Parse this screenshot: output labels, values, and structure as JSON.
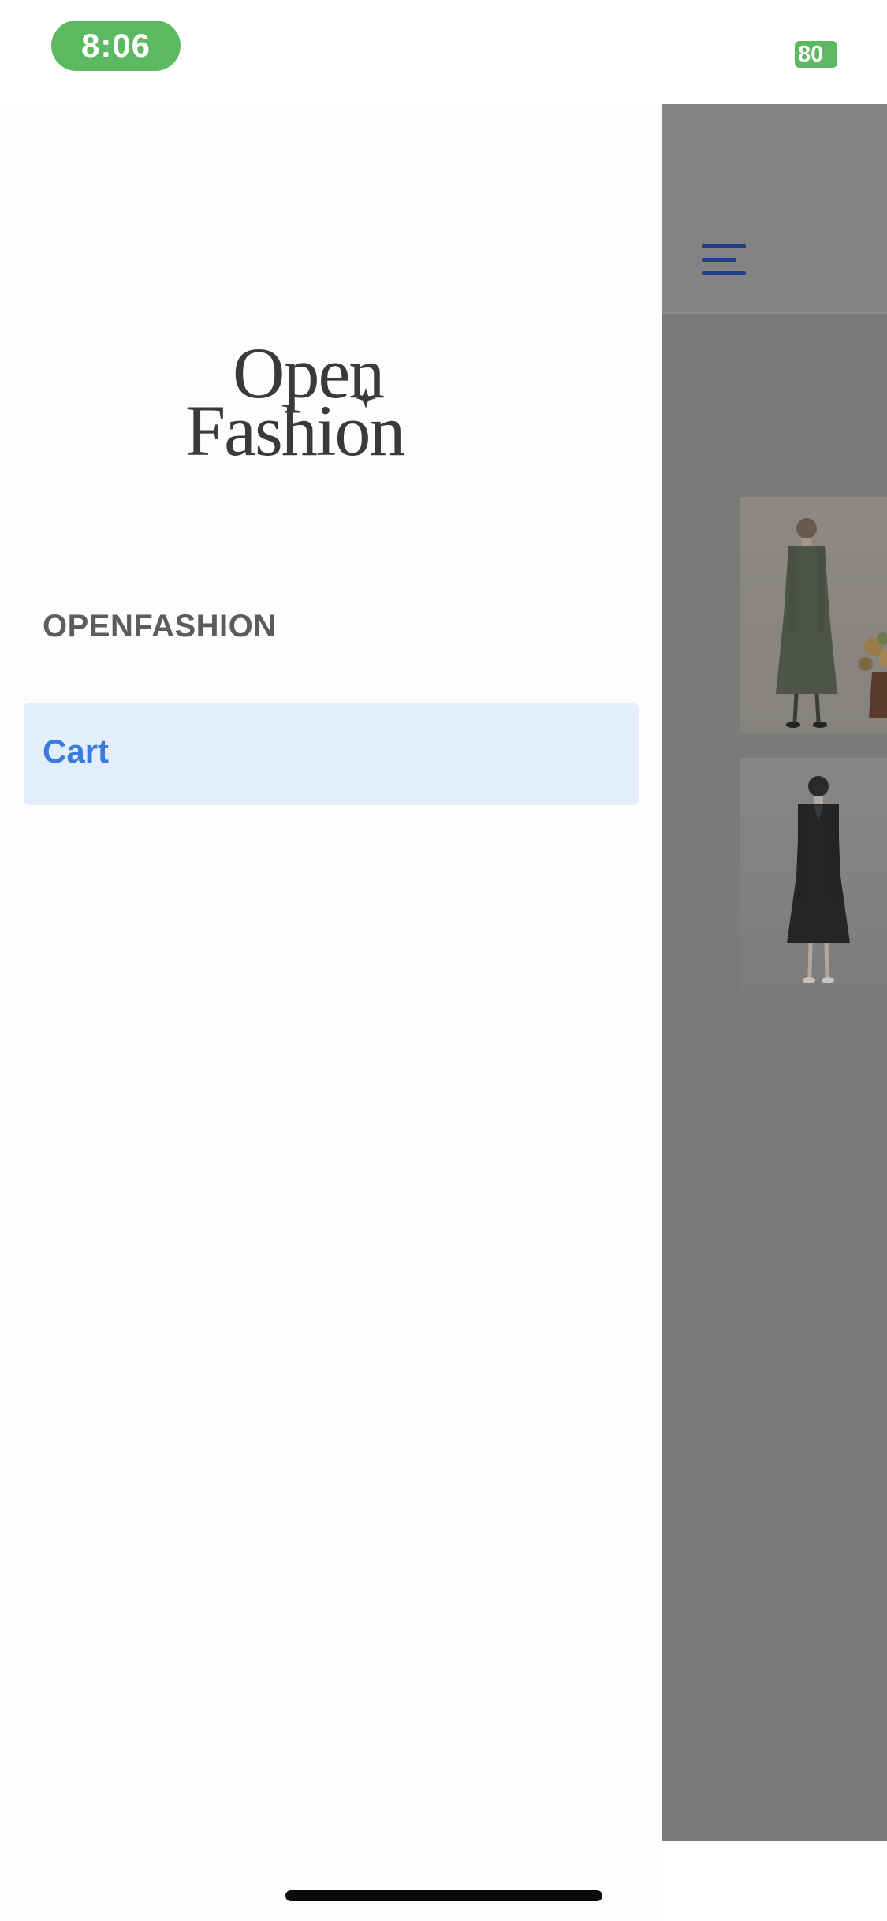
{
  "status_bar": {
    "time": "8:06",
    "battery": "80",
    "accent_color": "#5db862"
  },
  "drawer": {
    "logo_text": "Open Fashion",
    "section_title": "OPENFASHION",
    "items": [
      {
        "label": "Cart",
        "selected": true,
        "highlight_color": "#e2eefc",
        "text_color": "#3b7be0"
      }
    ]
  },
  "background_app": {
    "menu_icon": "hamburger-menu-icon",
    "overlay_color": "#7a7a7a",
    "products": [
      {
        "kind": "product-image",
        "subject": "green midi coat dress"
      },
      {
        "kind": "product-image",
        "subject": "black midi coat dress"
      }
    ]
  }
}
